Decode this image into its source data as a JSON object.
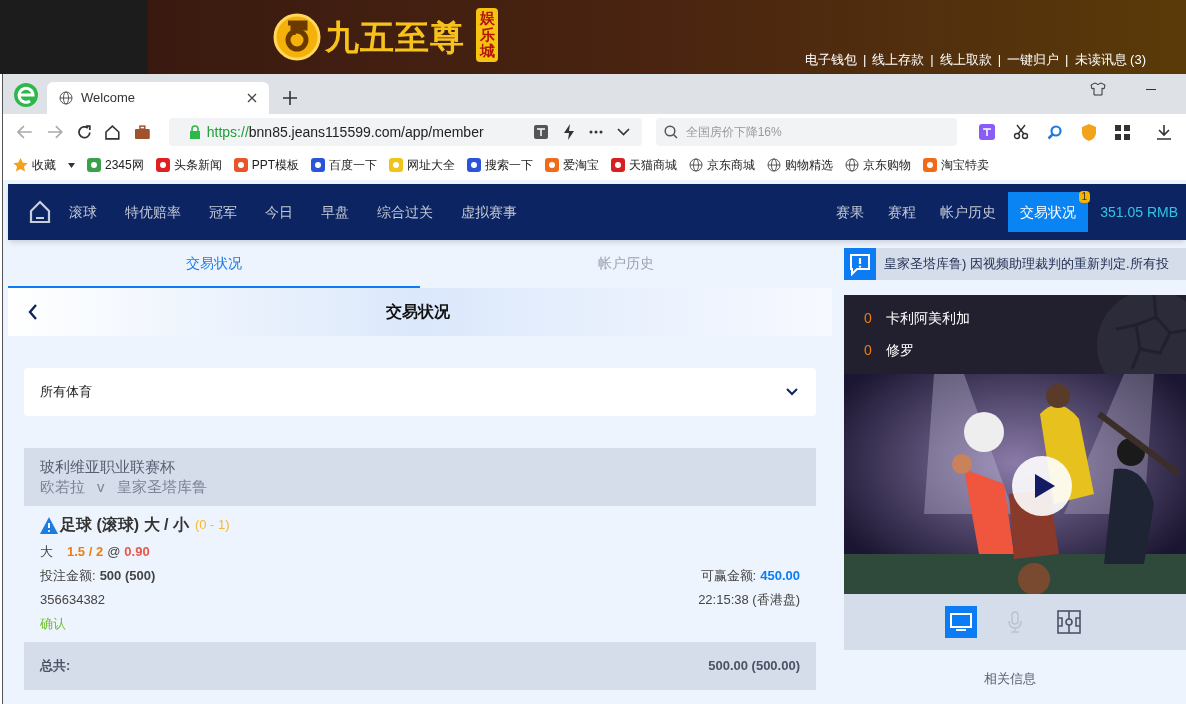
{
  "site_header": {
    "logo_text": "九五至尊",
    "logo_badge": "娱乐城",
    "links": [
      "电子钱包",
      "线上存款",
      "线上取款",
      "一键归户",
      "未读讯息 (3)"
    ],
    "separator": "|"
  },
  "browser": {
    "tabs": [
      {
        "title": "Welcome",
        "selected": true
      }
    ],
    "address": {
      "scheme": "https://",
      "rest": "bnn85.jeans115599.com/app/member"
    },
    "search": {
      "placeholder": "全国房价下降16%"
    },
    "bookmarks": [
      "收藏",
      "2345网",
      "头条新闻",
      "PPT模板",
      "百度一下",
      "网址大全",
      "搜索一下",
      "爱淘宝",
      "天猫商城",
      "京东商城",
      "购物精选",
      "京东购物",
      "淘宝特卖"
    ]
  },
  "nav": {
    "left": [
      "滚球",
      "特优赔率",
      "冠军",
      "今日",
      "早盘",
      "综合过关",
      "虚拟赛事"
    ],
    "right": [
      {
        "label": "赛果",
        "selected": false
      },
      {
        "label": "赛程",
        "selected": false
      },
      {
        "label": "帐户历史",
        "selected": false
      },
      {
        "label": "交易状况",
        "selected": true,
        "badge": "1"
      }
    ],
    "balance": "351.05 RMB"
  },
  "page_tabs": [
    {
      "label": "交易状况",
      "selected": true
    },
    {
      "label": "帐户历史",
      "selected": false
    }
  ],
  "page_title": "交易状况",
  "sport_select": {
    "value": "所有体育"
  },
  "bet": {
    "league": "玻利维亚职业联赛杯",
    "home": "欧若拉",
    "vs": "v",
    "away": "皇家圣塔库鲁",
    "title": "足球 (滚球) 大 / 小",
    "score": "(0 - 1)",
    "selection": "大",
    "line": "1.5 / 2",
    "at": "@",
    "odds": "0.90",
    "stake_label": "投注金额:",
    "stake_value": "500 (500)",
    "win_label": "可赢金额:",
    "win_value": "450.00",
    "ticket": "356634382",
    "time": "22:15:38 (香港盘)",
    "status": "确认"
  },
  "total": {
    "label": "总共:",
    "value": "500.00 (500.00)"
  },
  "notice": "皇家圣塔库鲁) 因视频助理裁判的重新判定.所有投",
  "scoreboard": [
    {
      "score": "0",
      "team": "卡利阿美利加"
    },
    {
      "score": "0",
      "team": "修罗"
    }
  ],
  "media_buttons": [
    {
      "kind": "tv",
      "selected": true,
      "disabled": false
    },
    {
      "kind": "mic",
      "selected": false,
      "disabled": true
    },
    {
      "kind": "field",
      "selected": false,
      "disabled": false
    }
  ],
  "related": "相关信息"
}
